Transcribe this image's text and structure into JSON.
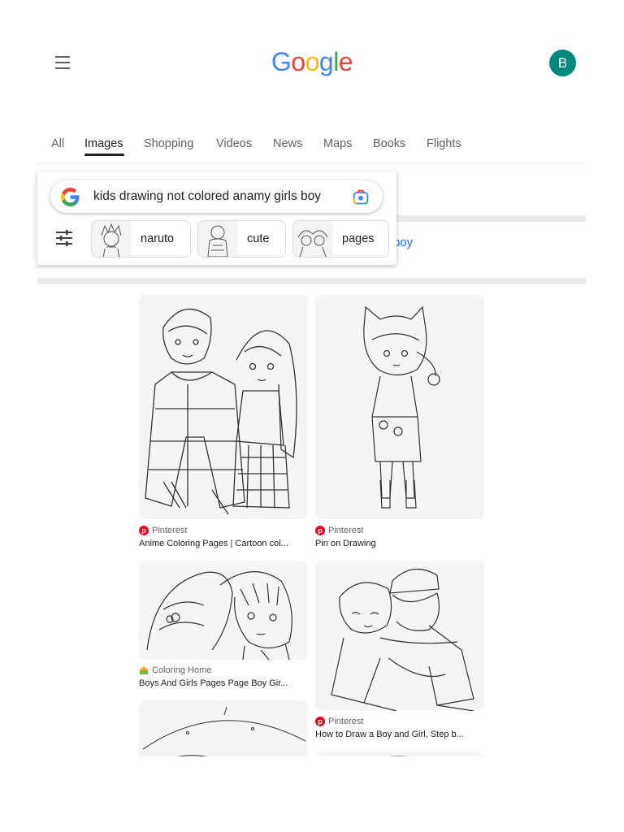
{
  "header": {
    "logo_letters": [
      "G",
      "o",
      "o",
      "g",
      "l",
      "e"
    ],
    "avatar_letter": "B"
  },
  "tabs": [
    {
      "label": "All"
    },
    {
      "label": "Images",
      "active": true
    },
    {
      "label": "Shopping"
    },
    {
      "label": "Videos"
    },
    {
      "label": "News"
    },
    {
      "label": "Maps"
    },
    {
      "label": "Books"
    },
    {
      "label": "Flights"
    }
  ],
  "search": {
    "query": "kids drawing not colored anamy  girls boy",
    "behind_text": "boy"
  },
  "chips": [
    {
      "label": "naruto"
    },
    {
      "label": "cute"
    },
    {
      "label": "pages"
    }
  ],
  "results": [
    {
      "source": "Pinterest",
      "title": "Anime Coloring Pages | Cartoon col..."
    },
    {
      "source": "Pinterest",
      "title": "Pin on Drawing"
    },
    {
      "source": "Coloring Home",
      "title": "Boys And Girls Pages Page Boy Gir..."
    },
    {
      "source": "Pinterest",
      "title": "How to Draw a Boy and Girl, Step b..."
    }
  ],
  "colors": {
    "accent_blue": "#1a73e8",
    "avatar_bg": "#00897b",
    "pinterest_red": "#e60023"
  },
  "icons": [
    "menu-icon",
    "google-g-icon",
    "lens-icon",
    "filter-icon",
    "pinterest-icon",
    "coloring-home-icon"
  ]
}
